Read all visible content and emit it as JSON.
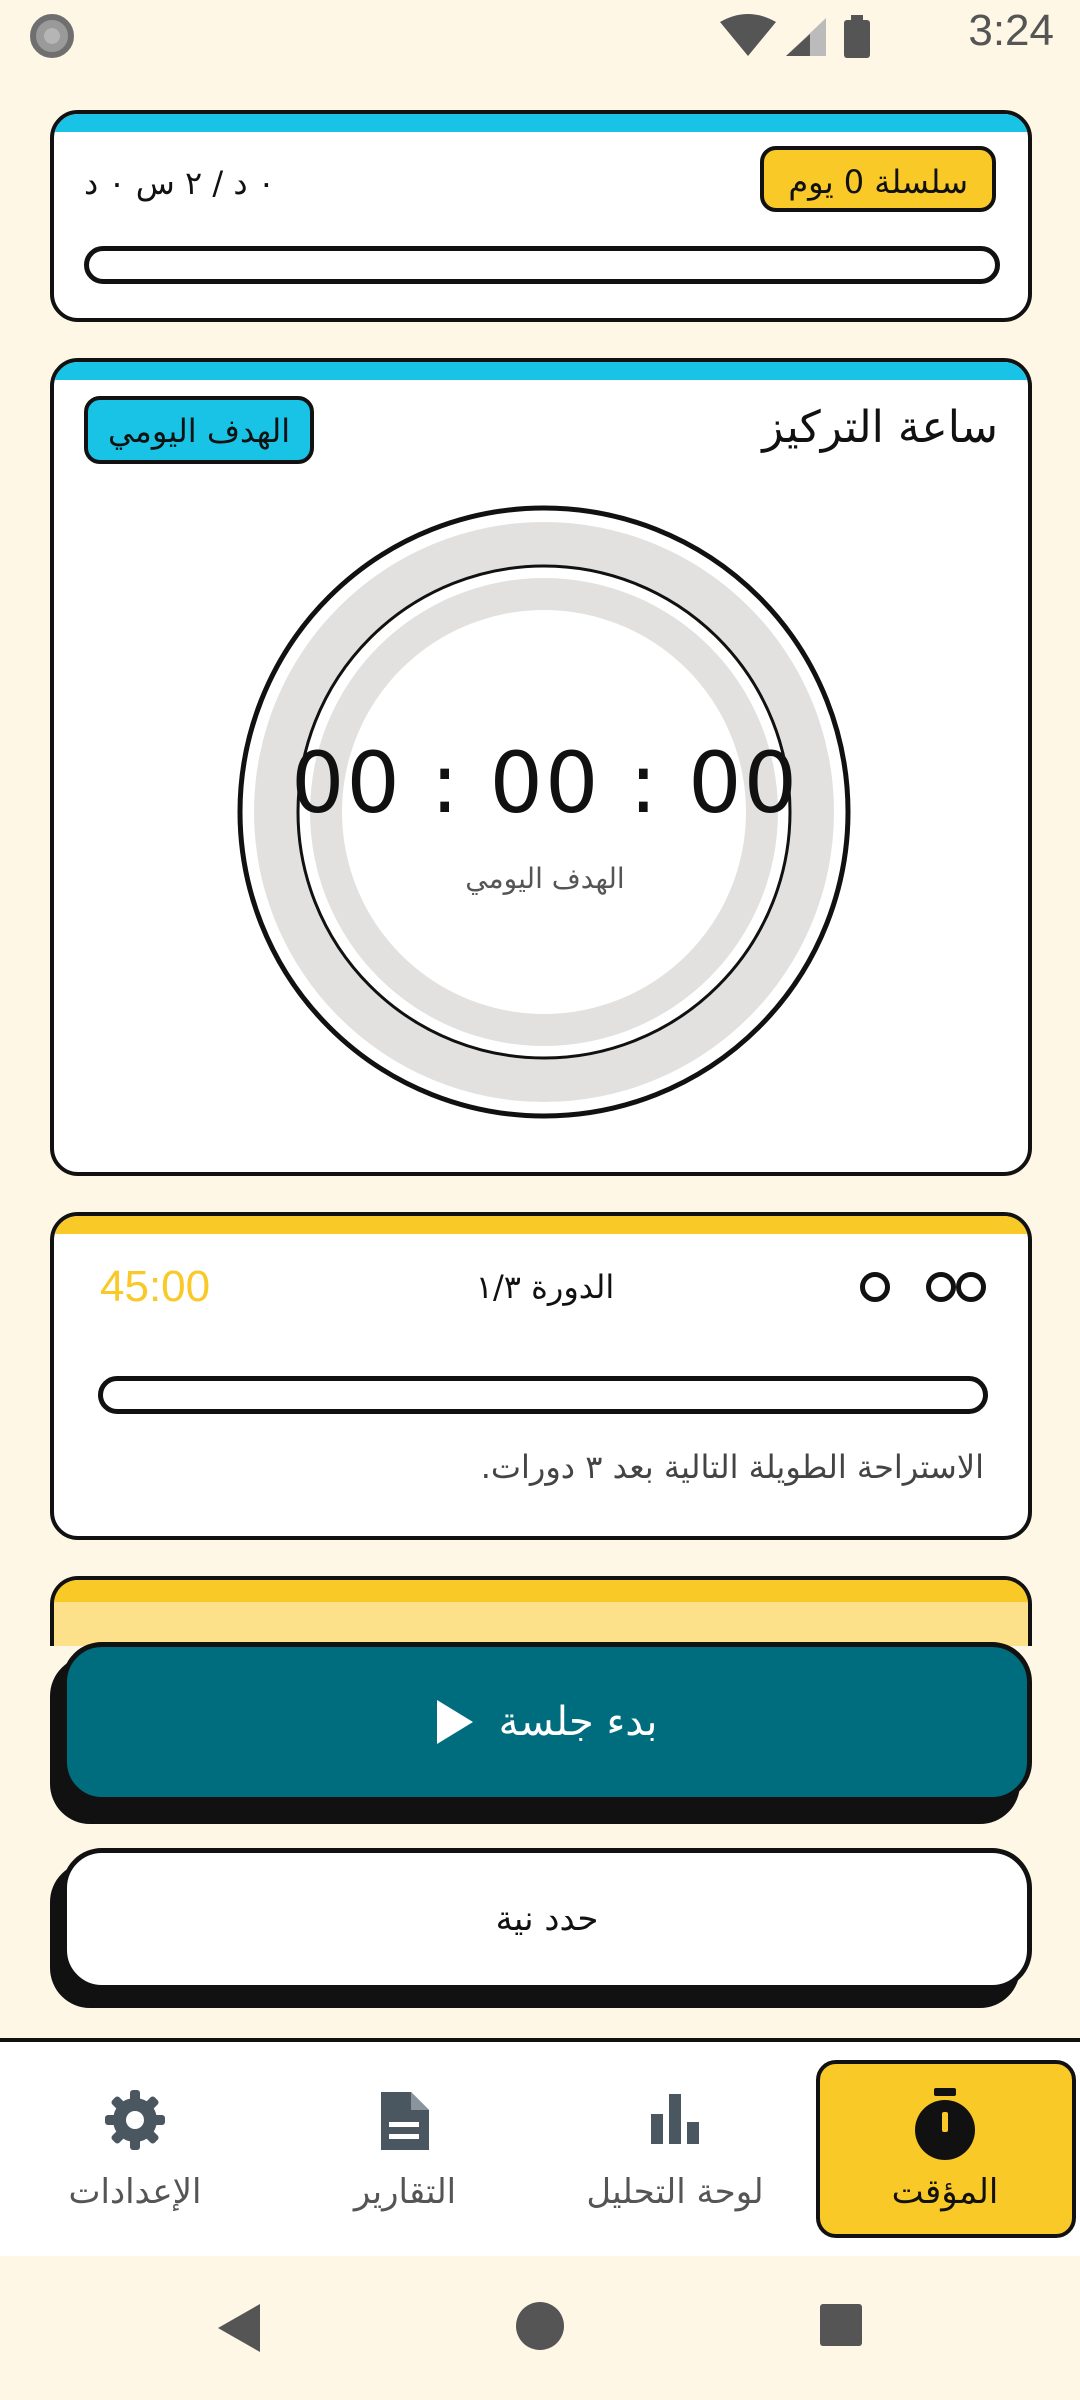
{
  "status_bar": {
    "time": "3:24"
  },
  "streak_card": {
    "streak_badge": "سلسلة 0 يوم",
    "time_summary": "٠ د / ٢ س ٠ د",
    "progress": 0
  },
  "focus_card": {
    "title": "ساعة التركيز",
    "goal_badge": "الهدف اليومي",
    "clock_time": "00 : 00 : 00",
    "clock_label": "الهدف اليومي",
    "progress": 0
  },
  "cycle_card": {
    "remaining_time": "45:00",
    "cycle_label": "الدورة ١/٣",
    "dots_total": 3,
    "progress": 0,
    "note": "الاستراحة الطويلة التالية بعد ٣ دورات."
  },
  "actions": {
    "start_label": "بدء جلسة",
    "intent_label": "حدد نية"
  },
  "bottom_nav": {
    "items": [
      {
        "label": "المؤقت",
        "icon": "stopwatch-icon",
        "active": true
      },
      {
        "label": "لوحة التحليل",
        "icon": "bar-chart-icon",
        "active": false
      },
      {
        "label": "التقارير",
        "icon": "document-icon",
        "active": false
      },
      {
        "label": "الإعدادات",
        "icon": "gear-icon",
        "active": false
      }
    ]
  },
  "colors": {
    "background": "#FFF7E6",
    "accent_yellow": "#F9C928",
    "accent_cyan": "#19C3E6",
    "primary_teal": "#006D7E"
  }
}
